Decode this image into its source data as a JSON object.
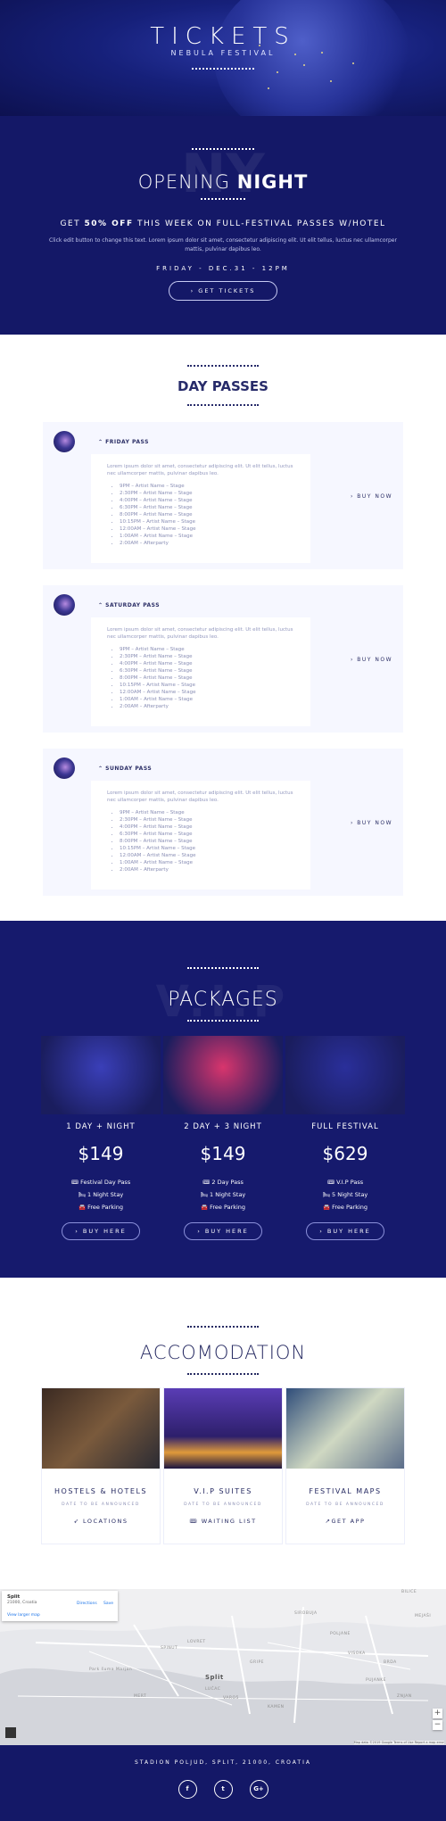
{
  "hero": {
    "title": "TICKETS",
    "subtitle": "NEBULA FESTIVAL"
  },
  "opening": {
    "ghost": "NY",
    "title_light": "OPENING ",
    "title_bold": "NIGHT",
    "promo_pre": "GET ",
    "promo_bold": "50% OFF",
    "promo_post": " THIS WEEK ON FULL-FESTIVAL PASSES W/HOTEL",
    "desc": "Click edit button to change this text. Lorem ipsum dolor sit amet, consectetur adipiscing elit. Ut elit tellus, luctus nec ullamcorper mattis, pulvinar dapibus leo.",
    "date": "FRIDAY - DEC.31 - 12PM",
    "button": "› GET TICKETS"
  },
  "day_passes": {
    "title": "DAY PASSES",
    "buy_label": "› BUY NOW",
    "intro": "Lorem ipsum dolor sit amet, consectetur adipiscing elit. Ut elit tellus, luctus nec ullamcorper mattis, pulvinar dapibus leo.",
    "passes": [
      {
        "name": "FRIDAY PASS",
        "items": [
          "9PM – Artist Name – Stage",
          "2:30PM – Artist Name – Stage",
          "4:00PM – Artist Name – Stage",
          "6:30PM – Artist Name – Stage",
          "8:00PM – Artist Name – Stage",
          "10:15PM – Artist Name – Stage",
          "12:00AM – Artist Name – Stage",
          "1:00AM – Artist Name – Stage",
          "2:00AM – Afterparty"
        ]
      },
      {
        "name": "SATURDAY PASS",
        "items": [
          "9PM – Artist Name – Stage",
          "2:30PM – Artist Name – Stage",
          "4:00PM – Artist Name – Stage",
          "6:30PM – Artist Name – Stage",
          "8:00PM – Artist Name – Stage",
          "10:15PM – Artist Name – Stage",
          "12:00AM – Artist Name – Stage",
          "1:00AM – Artist Name – Stage",
          "2:00AM – Afterparty"
        ]
      },
      {
        "name": "SUNDAY PASS",
        "items": [
          "9PM – Artist Name – Stage",
          "2:30PM – Artist Name – Stage",
          "4:00PM – Artist Name – Stage",
          "6:30PM – Artist Name – Stage",
          "8:00PM – Artist Name – Stage",
          "10:15PM – Artist Name – Stage",
          "12:00AM – Artist Name – Stage",
          "1:00AM – Artist Name – Stage",
          "2:00AM – Afterparty"
        ]
      }
    ]
  },
  "packages": {
    "title": "PACKAGES",
    "ghost": "V.I.P",
    "buy_label": "› BUY HERE",
    "items": [
      {
        "name": "1 DAY + NIGHT",
        "price": "$149",
        "features": [
          "🎟 Festival Day Pass",
          "🛏 1 Night Stay",
          "🚘 Free Parking"
        ],
        "color": "#3a3fb8"
      },
      {
        "name": "2 DAY + 3 NIGHT",
        "price": "$149",
        "features": [
          "🎟 2 Day Pass",
          "🛏 1 Night Stay",
          "🚘 Free Parking"
        ],
        "color": "#d8356d"
      },
      {
        "name": "FULL FESTIVAL",
        "price": "$629",
        "features": [
          "🎟 V.I.P Pass",
          "🛏 5 Night Stay",
          "🚘 Free Parking"
        ],
        "color": "#2a2f9a"
      }
    ]
  },
  "accomodation": {
    "title": "ACCOMODATION",
    "items": [
      {
        "name": "HOSTELS & HOTELS",
        "note": "DATE TO BE ANNOUNCED",
        "link": "➶ LOCATIONS"
      },
      {
        "name": "V.I.P SUITES",
        "note": "DATE TO BE ANNOUNCED",
        "link": "🎟 WAITING LIST"
      },
      {
        "name": "FESTIVAL MAPS",
        "note": "DATE TO BE ANNOUNCED",
        "link": "↗GET APP"
      }
    ]
  },
  "map": {
    "place": "Split",
    "address": "21000, Croatia",
    "view_link": "View larger map",
    "directions": "Directions",
    "save": "Save",
    "labels": [
      "Split",
      "SPINUT",
      "LOVRET",
      "GRIPE",
      "POLJANE",
      "VISOKA",
      "BRDA",
      "PUJANKE",
      "KAMEN",
      "BILICE",
      "MEJAŠI",
      "SIROBUJA",
      "ZNJAN",
      "VARO5",
      "LUČAC",
      "Park šuma Marjan",
      "MERT"
    ],
    "attribution": "Map data ©2019 Google   Terms of Use   Report a map error",
    "zoom_in": "+",
    "zoom_out": "−"
  },
  "footer": {
    "address": "STADION POLJUD, SPLIT, 21000, CROATIA",
    "social": [
      "f",
      "t",
      "G+"
    ]
  }
}
